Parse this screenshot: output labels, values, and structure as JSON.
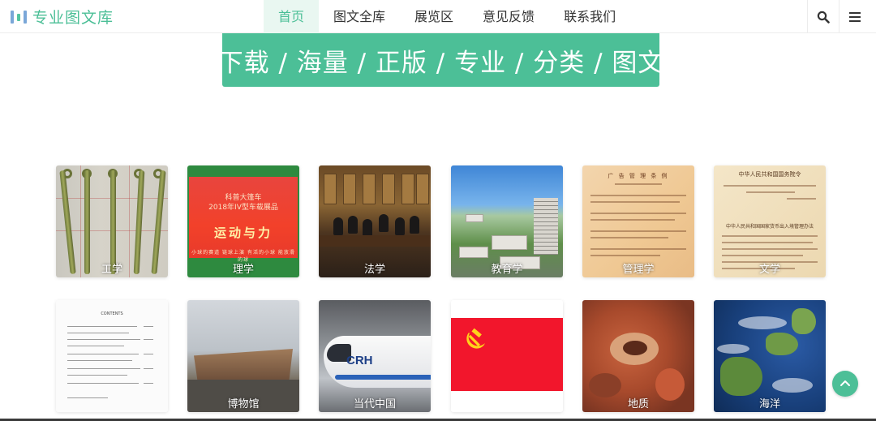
{
  "header": {
    "logo_text": "专业图文库",
    "nav": [
      {
        "label": "首页",
        "active": true
      },
      {
        "label": "图文全库",
        "active": false
      },
      {
        "label": "展览区",
        "active": false
      },
      {
        "label": "意见反馈",
        "active": false
      },
      {
        "label": "联系我们",
        "active": false
      }
    ],
    "icons": [
      "search-icon",
      "menu-icon"
    ]
  },
  "banner": {
    "text": "下载 / 海量 / 正版 / 专业 / 分类 / 图文"
  },
  "categories": [
    {
      "label": "工学"
    },
    {
      "label": "理学",
      "image_text": [
        "科普大篷车",
        "2018年IV型车载展品",
        "运动与力",
        "小球的赛道   链球上演   有活的小球   能放滑的球"
      ]
    },
    {
      "label": "法学"
    },
    {
      "label": "教育学"
    },
    {
      "label": "管理学",
      "image_text": [
        "广 告 管 理 条 例"
      ]
    },
    {
      "label": "文学",
      "image_text": [
        "中华人民共和国国务院令",
        "中华人民共和国国家货币出入境管理办法"
      ]
    },
    {
      "label": "",
      "image_text": [
        "CONTENTS"
      ]
    },
    {
      "label": "博物馆"
    },
    {
      "label": "当代中国",
      "image_text": [
        "CRH"
      ]
    },
    {
      "label": ""
    },
    {
      "label": "地质"
    },
    {
      "label": "海洋"
    }
  ],
  "colors": {
    "accent": "#4cbf97",
    "nav_active_bg": "#e9f7f1"
  },
  "back_to_top": {
    "icon": "chevron-up-icon"
  }
}
